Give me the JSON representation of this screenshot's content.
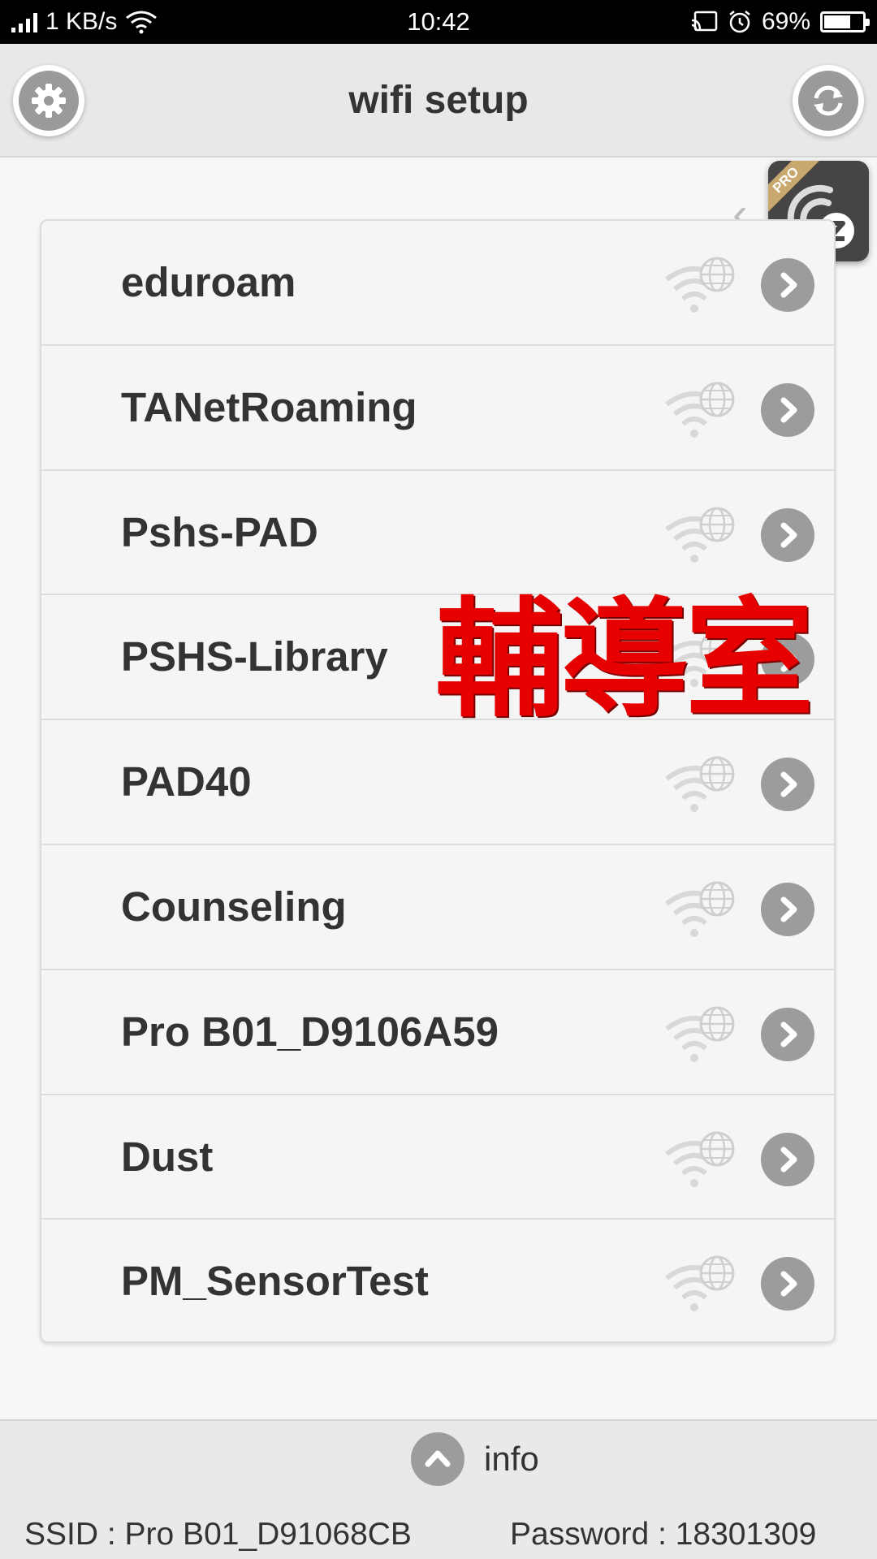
{
  "status_bar": {
    "speed": "1 KB/s",
    "time": "10:42",
    "battery": "69%",
    "battery_level": 0.69,
    "icons": [
      "signal-icon",
      "wifi-icon",
      "cast-icon",
      "alarm-icon",
      "battery-icon"
    ]
  },
  "header": {
    "title": "wifi setup",
    "left_icon": "gear-icon",
    "right_icon": "refresh-icon"
  },
  "pro_badge": {
    "label": "PRO"
  },
  "networks": [
    {
      "name": "eduroam"
    },
    {
      "name": "TANetRoaming"
    },
    {
      "name": "Pshs-PAD"
    },
    {
      "name": "PSHS-Library"
    },
    {
      "name": "PAD40"
    },
    {
      "name": "Counseling"
    },
    {
      "name": "Pro B01_D9106A59"
    },
    {
      "name": "Dust"
    },
    {
      "name": "PM_SensorTest"
    }
  ],
  "overlay_text": "輔導室",
  "footer": {
    "toggle_label": "info",
    "ssid": "SSID : Pro B01_D91068CB",
    "password": "Password : 18301309"
  },
  "colors": {
    "header_bg": "#e8e8e8",
    "button_grey": "#9c9c9c",
    "overlay_red": "#e60000",
    "pro_gold": "#c9a870"
  }
}
